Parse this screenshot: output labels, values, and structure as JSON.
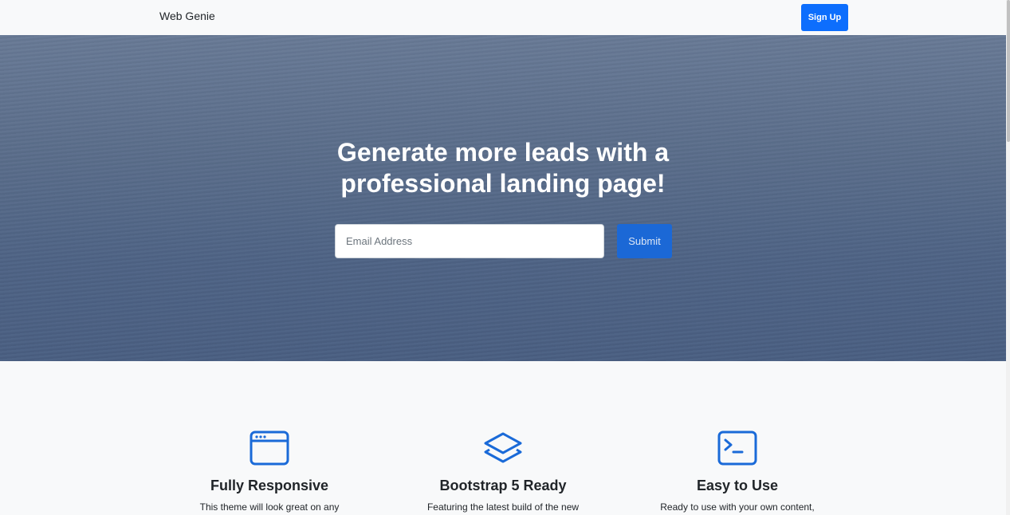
{
  "navbar": {
    "brand": "Web Genie",
    "signup_label": "Sign Up"
  },
  "hero": {
    "title": "Generate more leads with a professional landing page!",
    "email_placeholder": "Email Address",
    "submit_label": "Submit"
  },
  "features": [
    {
      "icon": "window-icon",
      "title": "Fully Responsive",
      "text": "This theme will look great on any"
    },
    {
      "icon": "layers-icon",
      "title": "Bootstrap 5 Ready",
      "text": "Featuring the latest build of the new"
    },
    {
      "icon": "terminal-icon",
      "title": "Easy to Use",
      "text": "Ready to use with your own content,"
    }
  ],
  "colors": {
    "primary": "#0d6efd",
    "icon": "#1a6ad8",
    "background": "#f8f9fa"
  }
}
